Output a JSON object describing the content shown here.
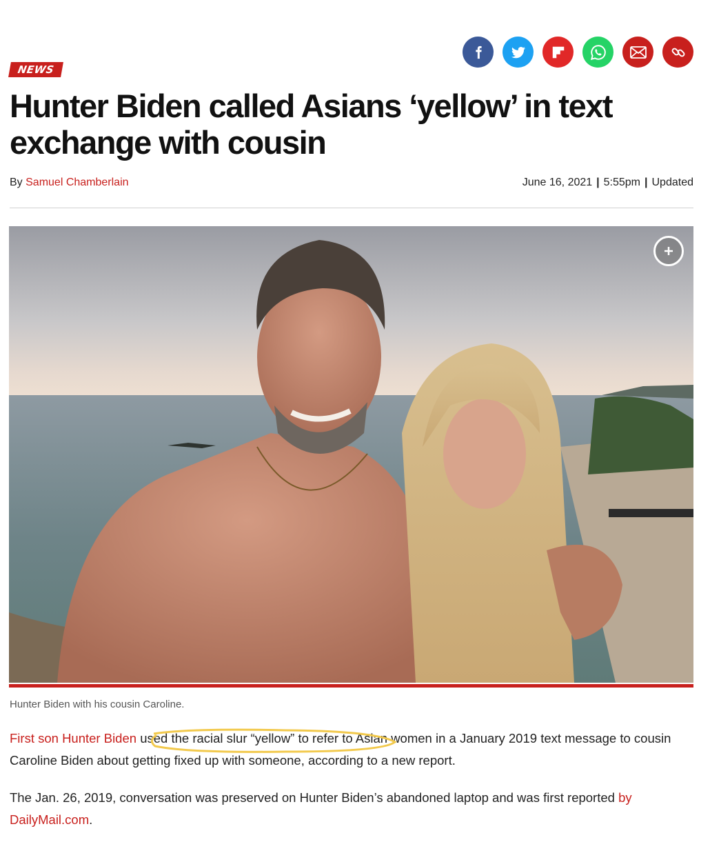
{
  "share": [
    {
      "name": "facebook",
      "icon": "facebook-icon",
      "color": "#3b5998"
    },
    {
      "name": "twitter",
      "icon": "twitter-icon",
      "color": "#1da1f2"
    },
    {
      "name": "flipboard",
      "icon": "flipboard-icon",
      "color": "#e12828"
    },
    {
      "name": "whatsapp",
      "icon": "whatsapp-icon",
      "color": "#25d366"
    },
    {
      "name": "email",
      "icon": "email-icon",
      "color": "#c8201d"
    },
    {
      "name": "link",
      "icon": "link-icon",
      "color": "#c8201d"
    }
  ],
  "article": {
    "section_badge": "NEWS",
    "headline": "Hunter Biden called Asians ‘yellow’ in text exchange with cousin",
    "byline_prefix": "By",
    "author": "Samuel Chamberlain",
    "date": "June 16, 2021",
    "time": "5:55pm",
    "updated_label": "Updated",
    "caption": "Hunter Biden with his cousin Caroline.",
    "p1_link": "First son Hunter Biden",
    "p1_rest": " used the racial slur “yellow” to refer to Asian women in a January 2019 text message to cousin Caroline Biden about getting fixed up with someone, according to a new report.",
    "p2_text": "The Jan. 26, 2019, conversation was preserved on Hunter Biden’s abandoned laptop and was first reported ",
    "p2_link": "by DailyMail.com",
    "p2_end": "."
  },
  "colors": {
    "brand_red": "#c8201d",
    "highlight": "#f2c94c"
  }
}
